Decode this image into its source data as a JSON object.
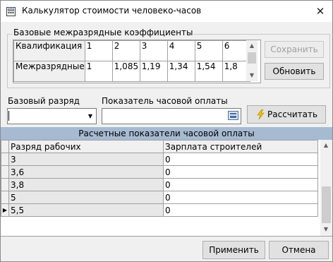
{
  "window": {
    "title": "Калькулятор стоимости человеко-часов",
    "close_glyph": "✕"
  },
  "coefficients": {
    "group_title": "Базовые межразрядные коэффициенты",
    "row_qualification": {
      "label": "Квалификация",
      "values": [
        "1",
        "2",
        "3",
        "4",
        "5",
        "6"
      ]
    },
    "row_interrank": {
      "label": "Межразрядные",
      "values": [
        "1",
        "1,085",
        "1,19",
        "1,34",
        "1,54",
        "1,8"
      ]
    },
    "save_label": "Сохранить",
    "refresh_label": "Обновить"
  },
  "form": {
    "base_rank_label": "Базовый разряд",
    "base_rank_value": "",
    "hourly_rate_label": "Показатель часовой оплаты",
    "hourly_rate_value": "",
    "calculate_label": "Рассчитать"
  },
  "results": {
    "title": "Расчетные показатели часовой оплаты",
    "columns": [
      "Разряд рабочих",
      "Зарплата строителей"
    ],
    "rows": [
      [
        "3",
        "0"
      ],
      [
        "3,6",
        "0"
      ],
      [
        "3,8",
        "0"
      ],
      [
        "5",
        "0"
      ],
      [
        "5,5",
        "0"
      ]
    ],
    "current_row_marker": "▶"
  },
  "footer": {
    "apply_label": "Применить",
    "cancel_label": "Отмена"
  },
  "colors": {
    "results_header_bg": "#a6bad2",
    "window_bg": "#f0f0f0"
  },
  "icons": [
    "app-icon",
    "close-icon",
    "dropdown-arrow-icon",
    "calculator-icon",
    "lightning-icon",
    "scroll-up-icon",
    "scroll-down-icon",
    "row-indicator-icon"
  ]
}
